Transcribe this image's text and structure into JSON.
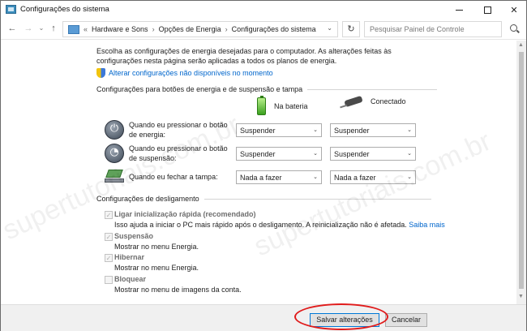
{
  "window": {
    "title": "Configurações do sistema"
  },
  "navbar": {
    "breadcrumbs": [
      "Hardware e Sons",
      "Opções de Energia",
      "Configurações do sistema"
    ],
    "search_placeholder": "Pesquisar Painel de Controle"
  },
  "intro": {
    "text": "Escolha as configurações de energia desejadas para o computador. As alterações feitas às configurações nesta página serão aplicadas a todos os planos de energia.",
    "admin_link": "Alterar configurações não disponíveis no momento"
  },
  "power_buttons": {
    "section_title": "Configurações para botões de energia e de suspensão e tampa",
    "col_battery": "Na bateria",
    "col_plugged": "Conectado",
    "rows": [
      {
        "label": "Quando eu pressionar o botão de energia:",
        "battery": "Suspender",
        "plugged": "Suspender"
      },
      {
        "label": "Quando eu pressionar o botão de suspensão:",
        "battery": "Suspender",
        "plugged": "Suspender"
      },
      {
        "label": "Quando eu fechar a tampa:",
        "battery": "Nada a fazer",
        "plugged": "Nada a fazer"
      }
    ]
  },
  "shutdown": {
    "section_title": "Configurações de desligamento",
    "items": [
      {
        "label": "Ligar inicialização rápida (recomendado)",
        "desc": "Isso ajuda a iniciar o PC mais rápido após o desligamento. A reinicialização não é afetada.",
        "link": "Saiba mais",
        "checked": true
      },
      {
        "label": "Suspensão",
        "desc": "Mostrar no menu Energia.",
        "checked": true
      },
      {
        "label": "Hibernar",
        "desc": "Mostrar no menu Energia.",
        "checked": true
      },
      {
        "label": "Bloquear",
        "desc": "Mostrar no menu de imagens da conta.",
        "checked": false
      }
    ]
  },
  "footer": {
    "save": "Salvar alterações",
    "cancel": "Cancelar"
  },
  "watermark": {
    "text": "supertutoriais.com.br"
  },
  "colors": {
    "link": "#0066cc",
    "highlight_circle": "#e01b1b"
  }
}
